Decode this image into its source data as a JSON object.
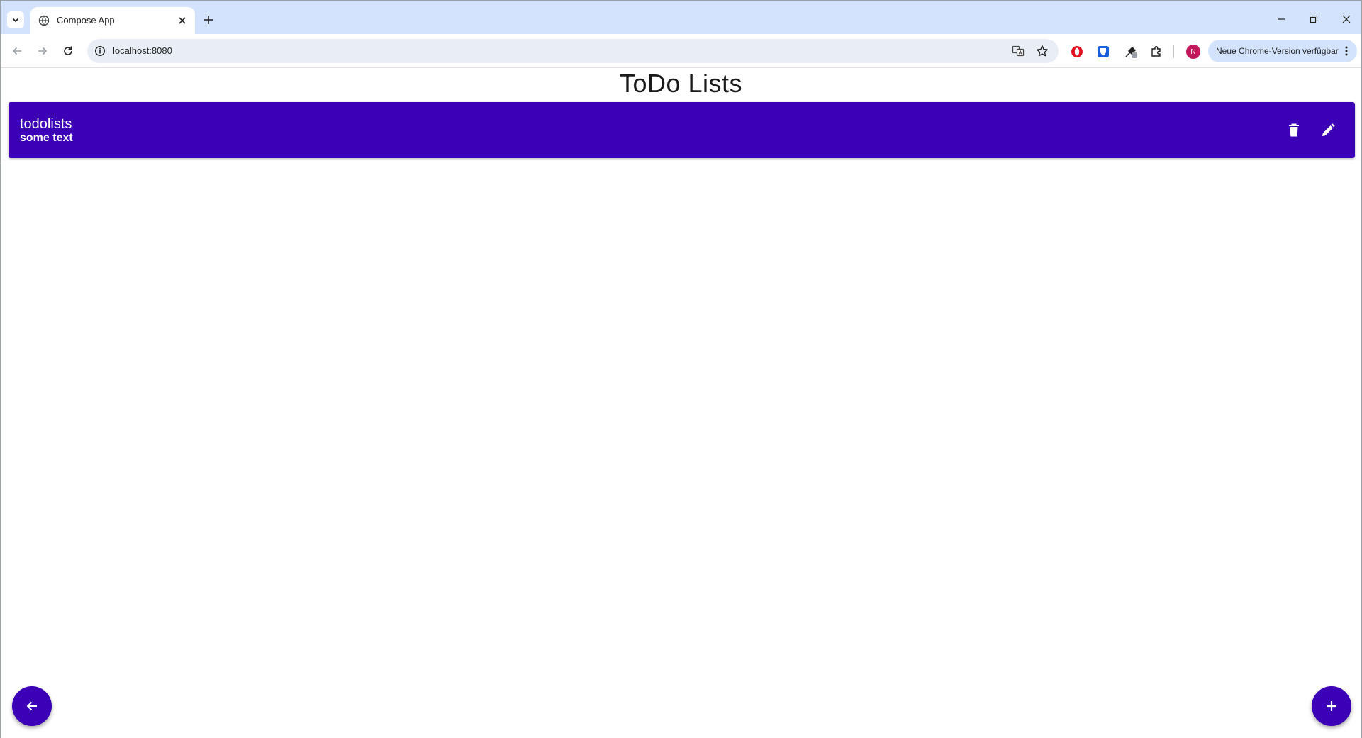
{
  "browser": {
    "tab": {
      "title": "Compose App"
    },
    "address_bar": {
      "url": "localhost:8080"
    },
    "profile": {
      "initial": "N",
      "color": "#c2185b"
    },
    "update_button": {
      "label": "Neue Chrome-Version verfügbar"
    }
  },
  "page": {
    "title": "ToDo Lists",
    "accent_color": "#3c00b7",
    "lists": [
      {
        "name": "todolists",
        "description": "some text"
      }
    ],
    "fab_back_icon": "arrow-left-icon",
    "fab_add_icon": "plus-icon"
  }
}
